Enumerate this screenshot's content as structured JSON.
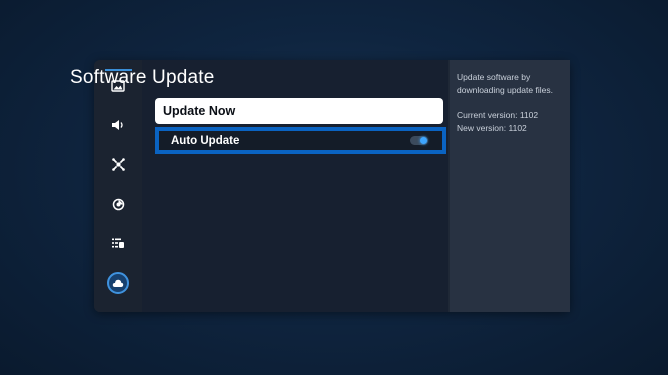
{
  "screen": {
    "title": "Software Update"
  },
  "sidebar": {
    "items": [
      {
        "icon": "picture-icon"
      },
      {
        "icon": "sound-icon"
      },
      {
        "icon": "connection-icon"
      },
      {
        "icon": "support-icon"
      },
      {
        "icon": "general-icon"
      },
      {
        "icon": "cloud-update-icon",
        "selected": true
      }
    ]
  },
  "menu": {
    "update_now_label": "Update Now",
    "auto_update_label": "Auto Update",
    "auto_update_enabled": true
  },
  "info": {
    "description_line1": "Update software by",
    "description_line2": "downloading update files.",
    "current_version": "Current version: 1102",
    "new_version": "New version: 1102"
  },
  "colors": {
    "accent": "#0a63c2",
    "toggle_on": "#3ea6ff",
    "panel": "#1f2836",
    "info_panel": "#283242"
  }
}
